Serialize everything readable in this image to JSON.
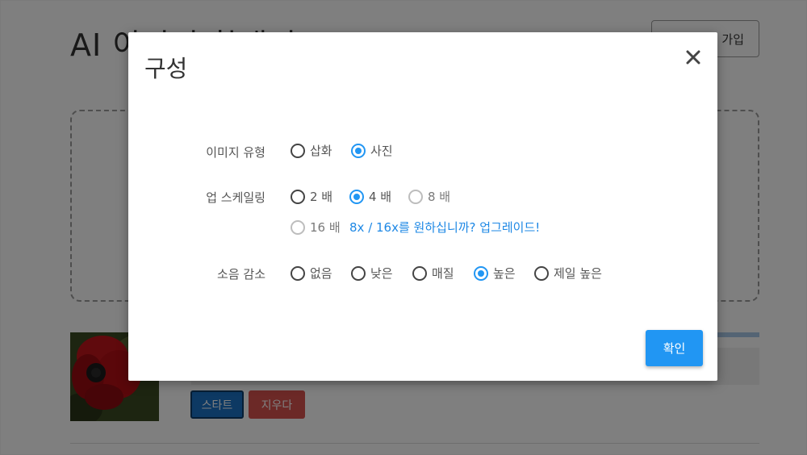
{
  "background": {
    "page_title": "AI 이미지 확대기",
    "signup_label": "가입",
    "start_label": "스타트",
    "clear_label": "지우다"
  },
  "modal": {
    "title": "구성",
    "close_icon": "close-icon",
    "image_type": {
      "label": "이미지 유형",
      "options": [
        {
          "label": "삽화",
          "checked": false
        },
        {
          "label": "사진",
          "checked": true
        }
      ]
    },
    "upscaling": {
      "label": "업 스케일링",
      "options": [
        {
          "label": "2 배",
          "checked": false
        },
        {
          "label": "4 배",
          "checked": true
        },
        {
          "label": "8 배",
          "checked": false,
          "disabled": true
        },
        {
          "label": "16 배",
          "checked": false,
          "disabled": true
        }
      ],
      "upgrade_link": "8x / 16x를 원하십니까? 업그레이드!"
    },
    "noise_reduction": {
      "label": "소음 감소",
      "options": [
        {
          "label": "없음",
          "checked": false
        },
        {
          "label": "낮은",
          "checked": false
        },
        {
          "label": "매질",
          "checked": false
        },
        {
          "label": "높은",
          "checked": true
        },
        {
          "label": "제일 높은",
          "checked": false
        }
      ]
    },
    "confirm_label": "확인"
  },
  "colors": {
    "accent": "#2196f3",
    "start_button": "#1a73c7",
    "clear_button": "#d9534f",
    "overlay": "rgba(0,0,0,0.5)"
  }
}
